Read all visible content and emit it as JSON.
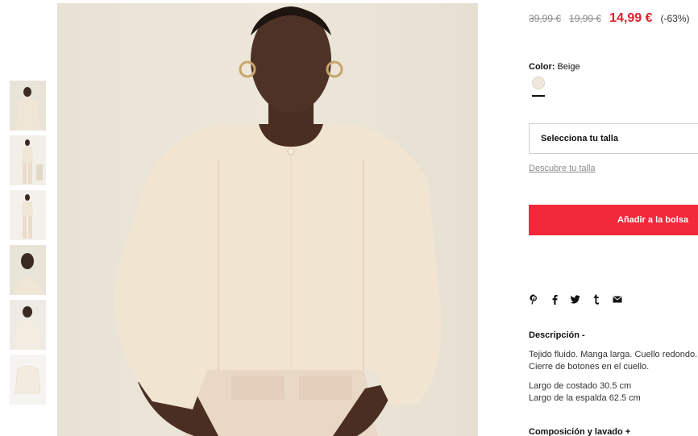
{
  "product": {
    "price_old_1": "39,99 €",
    "price_old_2": "19,99 €",
    "price_now": "14,99 €",
    "discount": "(-63%)"
  },
  "color": {
    "label": "Color:",
    "value": "Beige",
    "swatch_hex": "#efe9dc"
  },
  "size": {
    "select_label": "Selecciona tu talla",
    "guide_link": "Descubre tu talla"
  },
  "cart": {
    "add_label": "Añadir a la bolsa"
  },
  "share": {
    "icons": [
      "pinterest-icon",
      "facebook-icon",
      "twitter-icon",
      "tumblr-icon",
      "mail-icon"
    ]
  },
  "description": {
    "title": "Descripción -",
    "line1": "Tejido fluido. Manga larga. Cuello redondo.",
    "line2": "Cierre de botones en el cuello.",
    "line3": "Largo de costado 30.5 cm",
    "line4": "Largo de la espalda 62.5 cm"
  },
  "composition": {
    "title": "Composición y lavado +"
  },
  "gallery": {
    "thumbnail_count": 6
  }
}
